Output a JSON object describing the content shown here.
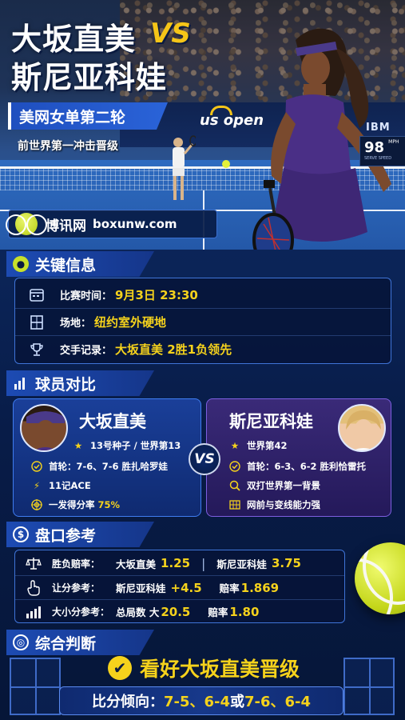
{
  "hero": {
    "title_line1": "大坂直美",
    "vs": "VS",
    "title_line2": "斯尼亚科娃",
    "round": "美网女单第二轮",
    "subtitle": "前世界第一冲击晋级",
    "event_logo": "us open",
    "sponsor": "IBM",
    "speed_value": "98",
    "speed_unit": "MPH",
    "speed_label": "SERVE SPEED",
    "brand_name": "博讯网",
    "brand_url": "boxunw.com"
  },
  "key_info": {
    "heading": "关键信息",
    "rows": [
      {
        "icon": "calendar-icon",
        "label": "比赛时间：",
        "value": "9月3日 23:30"
      },
      {
        "icon": "court-icon",
        "label": "场地：",
        "value": "纽约室外硬地"
      },
      {
        "icon": "trophy-icon",
        "label": "交手记录：",
        "value": "大坂直美  2胜1负领先"
      }
    ]
  },
  "compare": {
    "heading": "球员对比",
    "vs": "VS",
    "left": {
      "name": "大坂直美",
      "seed": "13号种子 / 世界第13",
      "first_round_label": "首轮：",
      "first_round": "7-6、7-6 胜扎哈罗娃",
      "aces": "11记ACE",
      "first_serve_label": "一发得分率",
      "first_serve_value": "75%"
    },
    "right": {
      "name": "斯尼亚科娃",
      "rank": "世界第42",
      "first_round_label": "首轮：",
      "first_round": "6-3、6-2 胜利恰雷托",
      "note1": "双打世界第一背景",
      "note2": "网前与变线能力强"
    }
  },
  "odds": {
    "heading": "盘口参考",
    "rows": [
      {
        "icon": "scale-icon",
        "label": "胜负赔率：",
        "a_name": "大坂直美",
        "a_val": "1.25",
        "sep": "|",
        "b_name": "斯尼亚科娃",
        "b_val": "3.75"
      },
      {
        "icon": "hand-icon",
        "label": "让分参考：",
        "a_name": "斯尼亚科娃",
        "a_val": "+4.5",
        "b_name": "赔率",
        "b_val": "1.869"
      },
      {
        "icon": "bars-icon",
        "label": "大小分参考：",
        "a_name": "总局数 大",
        "a_val": "20.5",
        "b_name": "赔率",
        "b_val": "1.80"
      }
    ]
  },
  "verdict": {
    "heading": "综合判断",
    "pick": "看好大坂直美晋级",
    "score_label": "比分倾向：",
    "score_a": "7-5、6-4",
    "or": " 或 ",
    "score_b": "7-6、6-4"
  },
  "colors": {
    "accent": "#f5d21c",
    "primary": "#1d4bb3",
    "purple": "#7d5fe0",
    "bg": "#071a44"
  }
}
